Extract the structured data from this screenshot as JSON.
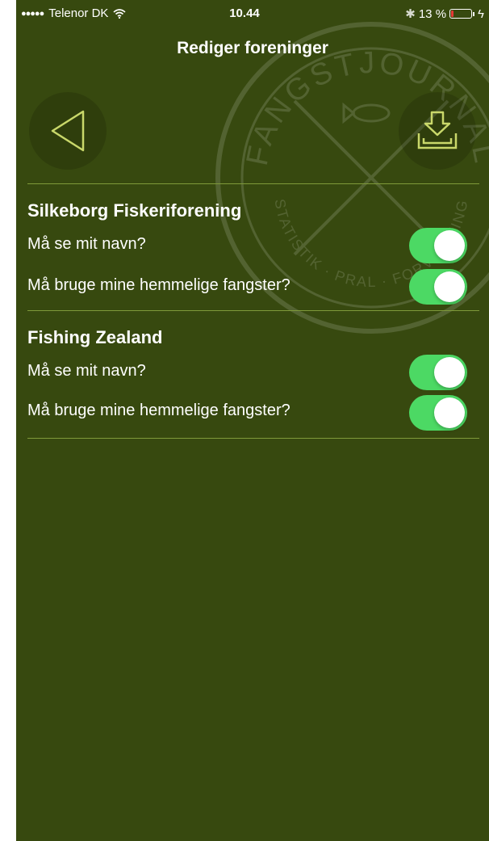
{
  "status_bar": {
    "signal": "●●●●●",
    "carrier": "Telenor DK",
    "time": "10.44",
    "battery_percent_label": "13 %",
    "battery_level": 0.13,
    "bluetooth_glyph": "✱",
    "charging_glyph": "ϟ"
  },
  "header": {
    "title": "Rediger foreninger"
  },
  "watermark": {
    "top_text": "FANGSTJOURNAL",
    "bottom_text": "STATISTIK · PRAL · FORVALTNING"
  },
  "icons": {
    "back": "back-triangle-icon",
    "save": "download-tray-icon",
    "wifi": "wifi-icon",
    "bluetooth": "bluetooth-icon",
    "battery": "battery-icon"
  },
  "colors": {
    "background": "#37490f",
    "accent_line": "#7f9a3a",
    "toggle_on": "#4cd964",
    "battery_low": "#e53935"
  },
  "groups": [
    {
      "name": "Silkeborg Fiskeriforening",
      "settings": [
        {
          "label": "Må se mit navn?",
          "enabled": true
        },
        {
          "label": "Må bruge mine hemmelige fangster?",
          "enabled": true
        }
      ]
    },
    {
      "name": "Fishing Zealand",
      "settings": [
        {
          "label": "Må se mit navn?",
          "enabled": true
        },
        {
          "label": "Må bruge mine hemmelige fangster?",
          "enabled": true
        }
      ]
    }
  ]
}
